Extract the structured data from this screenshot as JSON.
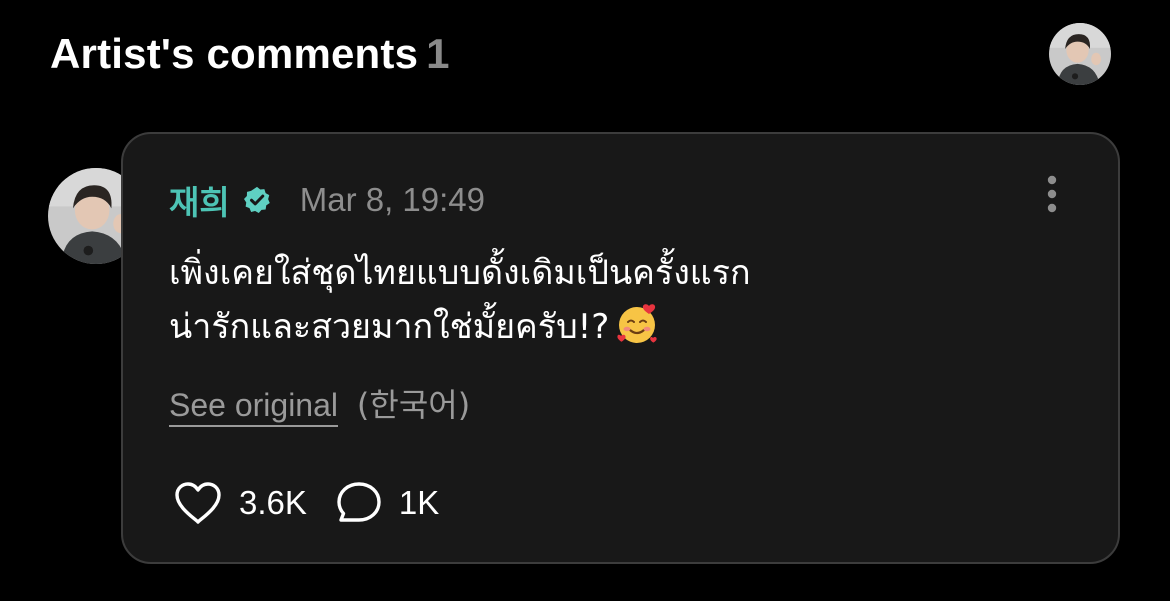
{
  "header": {
    "title": "Artist's comments",
    "count": "1"
  },
  "comment": {
    "author": "재희",
    "timestamp": "Mar 8, 19:49",
    "text_lines": [
      "เพิ่งเคยใส่ชุดไทยแบบดั้งเดิมเป็นครั้งแรก",
      "น่ารักและสวยมากใช่มั้ยครับ!?"
    ],
    "emoji": "smiling-face-with-hearts",
    "see_original": "See original",
    "original_language": "(한국어)",
    "likes": "3.6K",
    "replies": "1K"
  },
  "icons": {
    "verified": "verified-badge-icon",
    "more": "more-vertical-icon",
    "like": "heart-outline-icon",
    "reply": "speech-bubble-icon"
  },
  "colors": {
    "background": "#000000",
    "card": "#181818",
    "card_border": "#3c3c3c",
    "author": "#4dc4b5",
    "verified_badge": "#5fd0c2",
    "muted_text": "#8d8d8d"
  }
}
